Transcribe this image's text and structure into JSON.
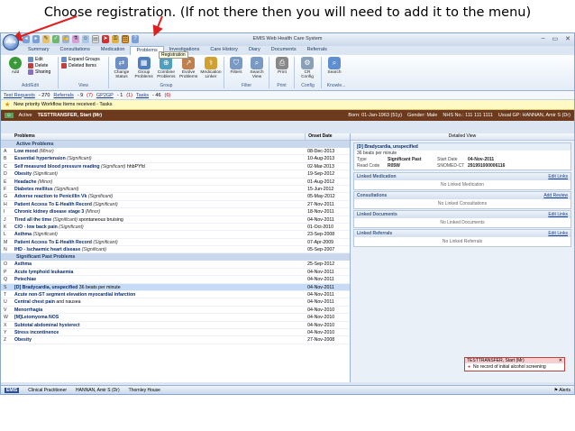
{
  "caption": "Choose registration. (If not there then you will need to add it to the menu)",
  "window": {
    "title": "EMIS Web Health Care System",
    "orb_label": "emis",
    "tooltip": "Registration"
  },
  "tabs": [
    "Summary",
    "Consultations",
    "Medication",
    "Problems",
    "Investigations",
    "Care History",
    "Diary",
    "Documents",
    "Referrals"
  ],
  "active_tab": "Problems",
  "ribbon": {
    "addedit": {
      "label": "Add/Edit",
      "add": "Add",
      "edit": "Edit",
      "delete": "Delete",
      "sharing": "Sharing"
    },
    "view": {
      "label": "View",
      "expand": "Expand Groups",
      "deleted": "Deleted Items"
    },
    "group": {
      "label": "Group",
      "change_status": "Change Status",
      "group_problems": "Group Problems",
      "combine": "Combine Problems",
      "evolve": "Evolve Problems",
      "med_linker": "Medication Linker"
    },
    "filter": {
      "label": "Filter",
      "filters": "Filters",
      "search_view": "Search View"
    },
    "print": {
      "label": "Print",
      "print": "Print"
    },
    "config": {
      "label": "Config",
      "cr_config": "CR Config"
    },
    "knowledge": {
      "label": "Knowle...",
      "search": "Search"
    }
  },
  "worklist": [
    {
      "label": "Test Requests",
      "count": "- 270"
    },
    {
      "label": "Referrals",
      "count": "- 9"
    },
    {
      "label": "GP2GP",
      "count": "- 1"
    },
    {
      "label": "Tasks",
      "count": "- 46"
    }
  ],
  "worklist_badges": [
    "(7)",
    "(1)",
    "(6)"
  ],
  "notice": "New priority Workflow Items received - Tasks",
  "patient": {
    "status": "Active",
    "name": "TESTTRANSFER, Start (Mr)",
    "born": "Born: 01-Jan-1963 (51y)",
    "gender": "Gender: Male",
    "nhs": "NHS No.: 111 111 1111",
    "usual_gp": "Usual GP: HANNAN, Amir S (Dr)"
  },
  "problem_columns": {
    "problem": "Problems",
    "onset": "Onset Date"
  },
  "active_section": "Active Problems",
  "active_problems": [
    {
      "letter": "A",
      "name": "Low mood",
      "note": "(Minor)",
      "extra": "",
      "date": "08-Dec-2013"
    },
    {
      "letter": "B",
      "name": "Essential hypertension",
      "note": "(Significant)",
      "extra": "",
      "date": "10-Aug-2013"
    },
    {
      "letter": "C",
      "name": "Self measured blood pressure reading",
      "note": "(Significant)",
      "extra": "hhbPYfd",
      "date": "02-Mar-2013"
    },
    {
      "letter": "D",
      "name": "Obesity",
      "note": "(Significant)",
      "extra": "",
      "date": "19-Sep-2012"
    },
    {
      "letter": "E",
      "name": "Headache",
      "note": "(Minor)",
      "extra": "",
      "date": "01-Aug-2012"
    },
    {
      "letter": "F",
      "name": "Diabetes mellitus",
      "note": "(Significant)",
      "extra": "",
      "date": "15-Jun-2012"
    },
    {
      "letter": "G",
      "name": "Adverse reaction to Penicillin Vk",
      "note": "(Significant)",
      "extra": "",
      "date": "05-May-2012"
    },
    {
      "letter": "H",
      "name": "Patient Access To E-Health Record",
      "note": "(Significant)",
      "extra": "",
      "date": "27-Nov-2011"
    },
    {
      "letter": "I",
      "name": "Chronic kidney disease stage 3",
      "note": "(Minor)",
      "extra": "",
      "date": "18-Nov-2011"
    },
    {
      "letter": "J",
      "name": "Tired all the time",
      "note": "(Significant)",
      "extra": "spontaneous bruising",
      "date": "04-Nov-2011"
    },
    {
      "letter": "K",
      "name": "C/O - low back pain",
      "note": "(Significant)",
      "extra": "",
      "date": "01-Oct-2010"
    },
    {
      "letter": "L",
      "name": "Asthma",
      "note": "(Significant)",
      "extra": "",
      "date": "23-Sep-2008"
    },
    {
      "letter": "M",
      "name": "Patient Access To E-Health Record",
      "note": "(Significant)",
      "extra": "",
      "date": "07-Apr-2009"
    },
    {
      "letter": "N",
      "name": "IHD - Ischaemic heart disease",
      "note": "(Significant)",
      "extra": "",
      "date": "05-Sep-2007"
    }
  ],
  "past_section": "Significant Past Problems",
  "past_problems": [
    {
      "letter": "O",
      "name": "Asthma",
      "note": "",
      "extra": "",
      "date": "25-Sep-2012"
    },
    {
      "letter": "P",
      "name": "Acute lymphoid leukaemia",
      "note": "",
      "extra": "",
      "date": "04-Nov-2011"
    },
    {
      "letter": "Q",
      "name": "Petechiae",
      "note": "",
      "extra": "",
      "date": "04-Nov-2011"
    },
    {
      "letter": "S",
      "name": "[D] Bradycardia, unspecified",
      "note": "",
      "extra": "36 beats per minute",
      "date": "04-Nov-2011"
    },
    {
      "letter": "T",
      "name": "Acute non-ST segment elevation myocardial infarction",
      "note": "",
      "extra": "",
      "date": "04-Nov-2011"
    },
    {
      "letter": "U",
      "name": "Central chest pain",
      "note": "",
      "extra": "and nausea",
      "date": "04-Nov-2011"
    },
    {
      "letter": "V",
      "name": "Menorrhagia",
      "note": "",
      "extra": "",
      "date": "04-Nov-2010"
    },
    {
      "letter": "W",
      "name": "[M]Leiomyoma NOS",
      "note": "",
      "extra": "",
      "date": "04-Nov-2010"
    },
    {
      "letter": "X",
      "name": "Subtotal abdominal hysterect",
      "note": "",
      "extra": "",
      "date": "04-Nov-2010"
    },
    {
      "letter": "Y",
      "name": "Stress incontinence",
      "note": "",
      "extra": "",
      "date": "04-Nov-2010"
    },
    {
      "letter": "Z",
      "name": "Obesity",
      "note": "",
      "extra": "",
      "date": "27-Nov-2008"
    }
  ],
  "detail": {
    "header": "Detailed View",
    "title": "[D] Bradycardia, unspecified",
    "subtitle": "36 beats per minute",
    "type_label": "Type",
    "type_value": "Significant  Past",
    "start_label": "Start Date",
    "start_value": "04-Nov-2011",
    "readcode_label": "Read Code",
    "readcode_value": "R05W",
    "snomed_label": "SNOMED-CT",
    "snomed_value": "291991000006116",
    "sections": [
      {
        "title": "Linked Medication",
        "action": "Edit Links",
        "empty": "No Linked Medication"
      },
      {
        "title": "Consultations",
        "action": "Add Review",
        "empty": "No Linked Consultations"
      },
      {
        "title": "Linked Documents",
        "action": "Edit Links",
        "empty": "No Linked Documents"
      },
      {
        "title": "Linked Referrals",
        "action": "Edit Links",
        "empty": "No Linked Referrals"
      }
    ]
  },
  "alert": {
    "patient": "TESTTRANSFER, Start (Mr)",
    "message": "No record of initial alcohol screening"
  },
  "statusbar": {
    "logo": "EMIS",
    "role": "Clinical Practitioner",
    "user": "HANNAN, Amir S (Dr)",
    "location": "Thornley House",
    "alerts": "Alerts"
  }
}
